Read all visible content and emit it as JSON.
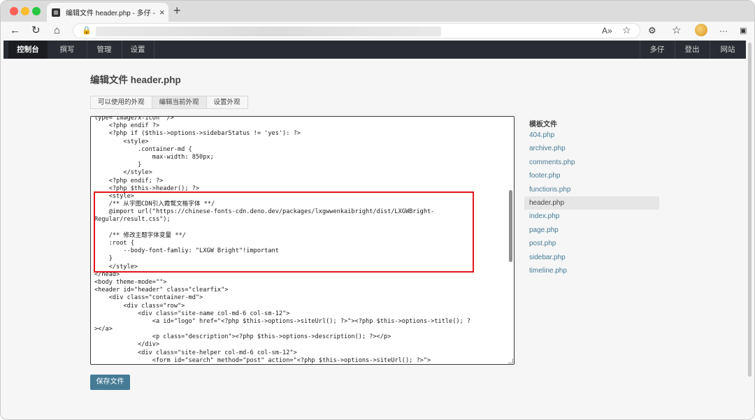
{
  "browser": {
    "tab_title": "编辑文件 header.php - 多仔 - Po",
    "tab_close": "×",
    "new_tab": "+",
    "nav_icons": {
      "back": "←",
      "reload": "↻",
      "home": "⌂"
    },
    "addr_icons": {
      "lock": "🔒",
      "read_aloud": "A»",
      "favorite": "☆"
    },
    "right_icons": {
      "extensions": "⚙",
      "favorites": "☆",
      "more": "···",
      "sidebar": "▣"
    }
  },
  "adminbar": {
    "left": [
      "控制台",
      "撰写",
      "管理",
      "设置"
    ],
    "right": [
      "多仔",
      "登出",
      "网站"
    ]
  },
  "page_title": "编辑文件 header.php",
  "subtabs": [
    "可以使用的外观",
    "编辑当前外观",
    "设置外观"
  ],
  "editor": {
    "lines": [
      "type=\"image/x-icon\" />",
      "    <?php endif ?>",
      "    <?php if ($this->options->sidebarStatus != 'yes'): ?>",
      "        <style>",
      "            .container-md {",
      "                max-width: 850px;",
      "            }",
      "        </style>",
      "    <?php endif; ?>",
      "    <?php $this->header(); ?>",
      "    <style>",
      "    /** 从字图CDN引入霞鹜文楷字体 **/",
      "    @import url(\"https://chinese-fonts-cdn.deno.dev/packages/lxgwwenkaibright/dist/LXGWBright-",
      "Regular/result.css\");",
      "",
      "    /** 修改主题字体变量 **/",
      "    :root {",
      "        --body-font-famliy: \"LXGW Bright\"!important",
      "    }",
      "    </style>",
      "</head>",
      "<body theme-mode=\"\">",
      "<header id=\"header\" class=\"clearfix\">",
      "    <div class=\"container-md\">",
      "        <div class=\"row\">",
      "            <div class=\"site-name col-md-6 col-sm-12\">",
      "                <a id=\"logo\" href=\"<?php $this->options->siteUrl(); ?>\"><?php $this->options->title(); ?",
      "></a>",
      "                <p class=\"description\"><?php $this->options->description(); ?></p>",
      "            </div>",
      "            <div class=\"site-helper col-md-6 col-sm-12\">",
      "                <form id=\"search\" method=\"post\" action=\"<?php $this->options->siteUrl(); ?>\">"
    ]
  },
  "save_button": "保存文件",
  "sidebar": {
    "title": "模板文件",
    "files": [
      "404.php",
      "archive.php",
      "comments.php",
      "footer.php",
      "functions.php",
      "header.php",
      "index.php",
      "page.php",
      "post.php",
      "sidebar.php",
      "timeline.php"
    ],
    "current": "header.php"
  },
  "colors": {
    "accent": "#467b96",
    "adminbar": "#292d33",
    "highlight_box": "#e0161c"
  }
}
